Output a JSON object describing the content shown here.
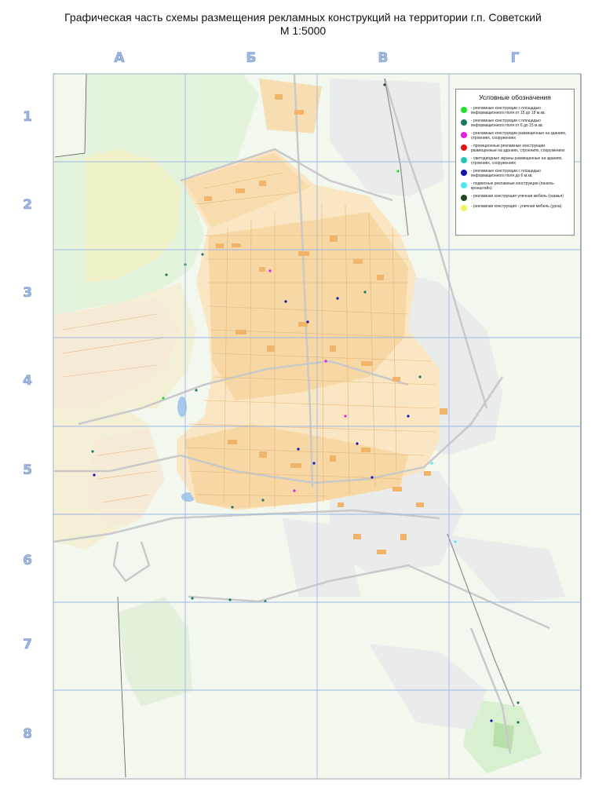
{
  "title": {
    "line1": "Графическая часть схемы размещения рекламных конструкций на территории г.п. Советский",
    "line2": "М 1:5000"
  },
  "grid": {
    "columns": [
      "А",
      "Б",
      "В",
      "Г"
    ],
    "rows": [
      "1",
      "2",
      "3",
      "4",
      "5",
      "6",
      "7",
      "8"
    ]
  },
  "legend": {
    "title": "Условные обозначения",
    "items": [
      {
        "color": "#22e02a",
        "text": "- рекламные конструкции с площадью информационного поля от 15 до 18 м.кв."
      },
      {
        "color": "#1a7a66",
        "text": "- рекламные конструкции с площадью информационного поля от 6 до 15 м.кв."
      },
      {
        "color": "#e61ee6",
        "text": "- рекламные конструкции размещенные на зданиях, строениях, сооружениях"
      },
      {
        "color": "#e01414",
        "text": "- проекционные рекламные конструкции размещенные на зданиях, строениях, сооружениях"
      },
      {
        "color": "#27c4b7",
        "text": "- светодиодные экраны размещенные на зданиях, строениях, сооружениях"
      },
      {
        "color": "#1414b4",
        "text": "- рекламные конструкции с площадью информационного поля до 6 м.кв."
      },
      {
        "color": "#4fe8f0",
        "text": "- подвесные рекламные конструкции (панель-кронштейн)"
      },
      {
        "color": "#1c4a1c",
        "text": "- рекламная конструкция уличная мебель (скамья)"
      },
      {
        "color": "#f2f25a",
        "text": "- рекламная конструкция - уличная мебель (урна)"
      }
    ]
  },
  "colors": {
    "background": "#f2f8ee",
    "greenery": "#d8f0d0",
    "fields": "#f2f1c8",
    "gridline": "#9db6e6",
    "buildings": "#f5c27f",
    "industrial": "#e8e8e8",
    "roads": "#cfcfcf"
  }
}
